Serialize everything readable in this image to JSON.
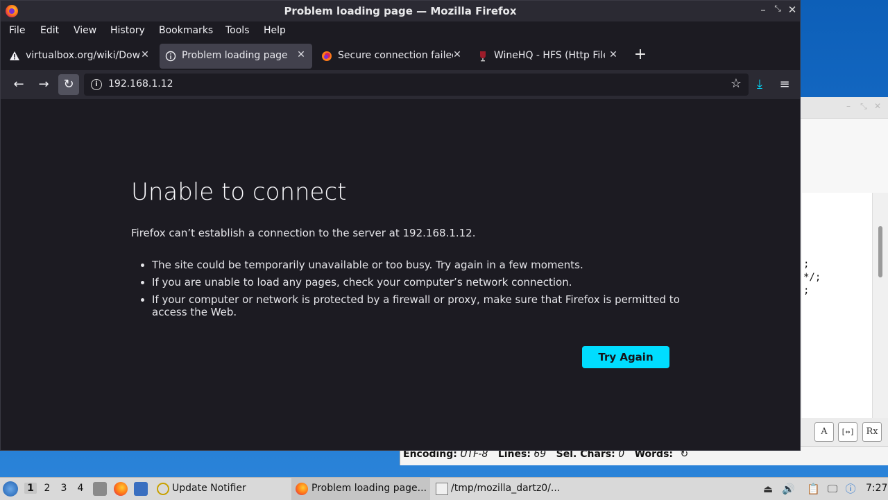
{
  "window": {
    "title": "Problem loading page — Mozilla Firefox",
    "controls": [
      "–",
      "⤡",
      "✕"
    ]
  },
  "menu": [
    "File",
    "Edit",
    "View",
    "History",
    "Bookmarks",
    "Tools",
    "Help"
  ],
  "tabs": [
    {
      "label": "virtualbox.org/wiki/Downl",
      "icon": "warning-icon",
      "active": false
    },
    {
      "label": "Problem loading page",
      "icon": "info-icon",
      "active": true
    },
    {
      "label": "Secure connection failed",
      "icon": "firefox-icon",
      "active": false
    },
    {
      "label": "WineHQ - HFS (Http File S",
      "icon": "winehq-icon",
      "active": false
    }
  ],
  "nav": {
    "url": "192.168.1.12"
  },
  "error": {
    "title": "Unable to connect",
    "description": "Firefox can’t establish a connection to the server at 192.168.1.12.",
    "bullets": [
      "The site could be temporarily unavailable or too busy. Try again in a few moments.",
      "If you are unable to load any pages, check your computer’s network connection.",
      "If your computer or network is protected by a firewall or proxy, make sure that Firefox is permitted to access the Web."
    ],
    "button": "Try Again"
  },
  "background_editor": {
    "lines": [
      ";",
      "*/;",
      ";"
    ],
    "format_buttons": [
      "A",
      "[↔]",
      "Rx"
    ],
    "status": {
      "encoding_label": "Encoding:",
      "encoding_value": "UTF-8",
      "lines_label": "Lines:",
      "lines_value": "69",
      "selchars_label": "Sel. Chars:",
      "selchars_value": "0",
      "words_label": "Words:"
    }
  },
  "taskbar": {
    "workspaces": [
      "1",
      "2",
      "3",
      "4"
    ],
    "tasks": [
      {
        "label": "Update Notifier"
      },
      {
        "label": "Problem loading page..."
      },
      {
        "label": "/tmp/mozilla_dartz0/..."
      }
    ],
    "clock": "7:27"
  },
  "colors": {
    "accent": "#00ddff",
    "chrome": "#2b2a33",
    "page_bg": "#1c1b22"
  }
}
